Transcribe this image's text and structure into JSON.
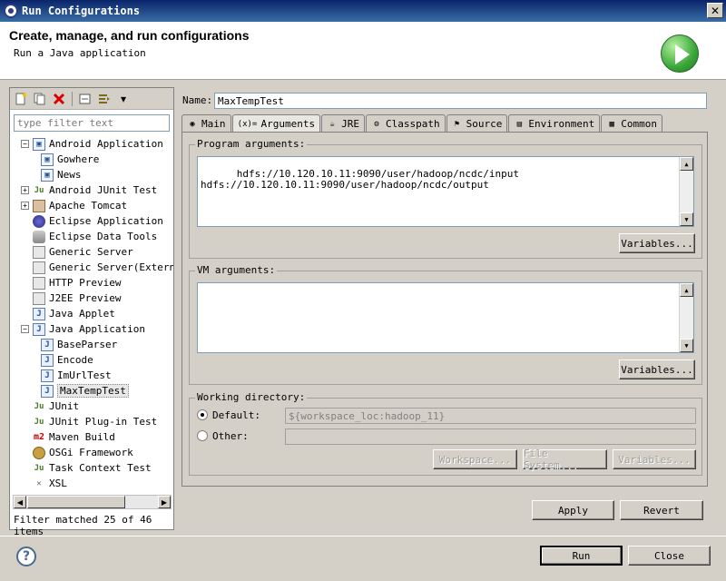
{
  "window": {
    "title": "Run Configurations"
  },
  "header": {
    "title": "Create, manage, and run configurations",
    "subtitle": "Run a Java application"
  },
  "filter": {
    "placeholder": "type filter text",
    "status": "Filter matched 25 of 46 items"
  },
  "tree": [
    {
      "label": "Android Application",
      "level": 0,
      "expander": "−",
      "icon": "android-app-icon"
    },
    {
      "label": "Gowhere",
      "level": 1,
      "icon": "android-app-icon"
    },
    {
      "label": "News",
      "level": 1,
      "icon": "android-app-icon"
    },
    {
      "label": "Android JUnit Test",
      "level": 0,
      "expander": "+",
      "icon": "junit-icon"
    },
    {
      "label": "Apache Tomcat",
      "level": 0,
      "expander": "+",
      "icon": "tomcat-icon"
    },
    {
      "label": "Eclipse Application",
      "level": 0,
      "icon": "eclipse-icon"
    },
    {
      "label": "Eclipse Data Tools",
      "level": 0,
      "icon": "database-icon"
    },
    {
      "label": "Generic Server",
      "level": 0,
      "icon": "server-icon"
    },
    {
      "label": "Generic Server(Externa",
      "level": 0,
      "icon": "server-icon"
    },
    {
      "label": "HTTP Preview",
      "level": 0,
      "icon": "server-icon"
    },
    {
      "label": "J2EE Preview",
      "level": 0,
      "icon": "server-icon"
    },
    {
      "label": "Java Applet",
      "level": 0,
      "icon": "applet-icon"
    },
    {
      "label": "Java Application",
      "level": 0,
      "expander": "−",
      "icon": "java-app-icon"
    },
    {
      "label": "BaseParser",
      "level": 1,
      "icon": "java-app-icon"
    },
    {
      "label": "Encode",
      "level": 1,
      "icon": "java-app-icon"
    },
    {
      "label": "ImUrlTest",
      "level": 1,
      "icon": "java-app-icon"
    },
    {
      "label": "MaxTempTest",
      "level": 1,
      "icon": "java-app-icon",
      "selected": true
    },
    {
      "label": "JUnit",
      "level": 0,
      "icon": "junit-icon"
    },
    {
      "label": "JUnit Plug-in Test",
      "level": 0,
      "icon": "junit-icon"
    },
    {
      "label": "Maven Build",
      "level": 0,
      "icon": "maven-icon"
    },
    {
      "label": "OSGi Framework",
      "level": 0,
      "icon": "osgi-icon"
    },
    {
      "label": "Task Context Test",
      "level": 0,
      "icon": "junit-icon"
    },
    {
      "label": "XSL",
      "level": 0,
      "icon": "xsl-icon"
    }
  ],
  "name": {
    "label": "Name:",
    "value": "MaxTempTest"
  },
  "tabs": [
    {
      "label": "Main",
      "icon": "main-icon"
    },
    {
      "label": "Arguments",
      "icon": "arguments-icon",
      "active": true
    },
    {
      "label": "JRE",
      "icon": "jre-icon"
    },
    {
      "label": "Classpath",
      "icon": "classpath-icon"
    },
    {
      "label": "Source",
      "icon": "source-icon"
    },
    {
      "label": "Environment",
      "icon": "environment-icon"
    },
    {
      "label": "Common",
      "icon": "common-icon"
    }
  ],
  "program_args": {
    "label": "Program arguments:",
    "value": "hdfs://10.120.10.11:9090/user/hadoop/ncdc/input\nhdfs://10.120.10.11:9090/user/hadoop/ncdc/output",
    "variables_button": "Variables..."
  },
  "vm_args": {
    "label": "VM arguments:",
    "value": "",
    "variables_button": "Variables..."
  },
  "working_dir": {
    "label": "Working directory:",
    "default_label": "Default:",
    "default_value": "${workspace_loc:hadoop_11}",
    "other_label": "Other:",
    "other_value": "",
    "workspace_button": "Workspace...",
    "filesystem_button": "File System...",
    "variables_button": "Variables..."
  },
  "actions": {
    "apply": "Apply",
    "revert": "Revert",
    "run": "Run",
    "close": "Close"
  },
  "help": "?"
}
